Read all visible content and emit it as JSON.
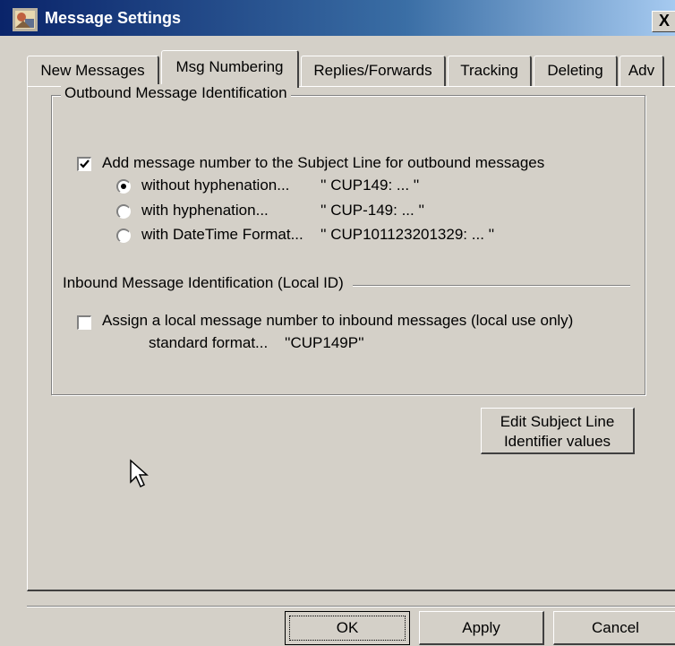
{
  "window": {
    "title": "Message Settings",
    "close_label": "X"
  },
  "tabs": [
    {
      "label": "New Messages"
    },
    {
      "label": "Msg Numbering",
      "active": true
    },
    {
      "label": "Replies/Forwards"
    },
    {
      "label": "Tracking"
    },
    {
      "label": "Deleting"
    },
    {
      "label": "Adv"
    }
  ],
  "outbound": {
    "group_label": "Outbound Message Identification",
    "add_number": {
      "label": "Add message number to the Subject Line for outbound messages",
      "checked": true
    },
    "options": [
      {
        "label": "without hyphenation...",
        "example": "'' CUP149: ... ''",
        "selected": true
      },
      {
        "label": "with hyphenation...",
        "example": "'' CUP-149: ... ''",
        "selected": false
      },
      {
        "label": "with DateTime Format...",
        "example": "'' CUP101123201329: ... ''",
        "selected": false
      }
    ]
  },
  "inbound": {
    "section_label": "Inbound Message Identification (Local ID)",
    "assign_local": {
      "label": "Assign a local message number to inbound messages (local use only)",
      "checked": false
    },
    "format_label": "standard format...",
    "format_example": "''CUP149P''"
  },
  "buttons": {
    "edit_line1": "Edit Subject Line",
    "edit_line2": "Identifier values",
    "ok": "OK",
    "apply": "Apply",
    "cancel": "Cancel"
  },
  "colors": {
    "face": "#d4d0c8",
    "title_start": "#0a246a",
    "title_end": "#a6caf0"
  },
  "icons": [
    "app-icon",
    "close-icon",
    "checkmark-icon",
    "mouse-pointer-icon"
  ]
}
